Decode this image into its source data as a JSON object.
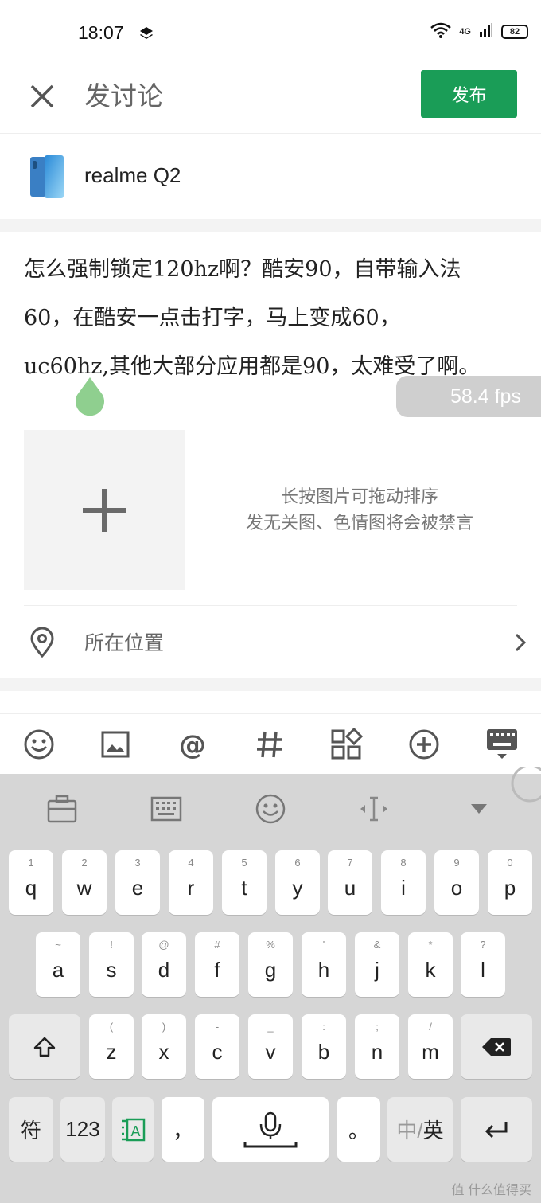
{
  "status": {
    "time": "18:07",
    "network": "4G",
    "battery": "82"
  },
  "header": {
    "title": "发讨论",
    "publish_label": "发布"
  },
  "device": {
    "name": "realme Q2"
  },
  "post": {
    "lines": [
      "怎么强制锁定120hz啊？酷安90，自带输入法",
      "60，在酷安一点击打字，马上变成60，",
      "uc60hz,其他大部分应用都是90，太难受了啊。"
    ]
  },
  "overlay": {
    "fps": "58.4 fps"
  },
  "image_picker": {
    "hint_line1": "长按图片可拖动排序",
    "hint_line2": "发无关图、色情图将会被禁言"
  },
  "location": {
    "label": "所在位置"
  },
  "toolbar": {
    "icons": [
      "emoji-icon",
      "image-icon",
      "at-icon",
      "hashtag-icon",
      "apps-icon",
      "add-circle-icon",
      "keyboard-hide-icon"
    ]
  },
  "keyboard": {
    "row1": [
      {
        "sub": "1",
        "key": "q"
      },
      {
        "sub": "2",
        "key": "w"
      },
      {
        "sub": "3",
        "key": "e"
      },
      {
        "sub": "4",
        "key": "r"
      },
      {
        "sub": "5",
        "key": "t"
      },
      {
        "sub": "6",
        "key": "y"
      },
      {
        "sub": "7",
        "key": "u"
      },
      {
        "sub": "8",
        "key": "i"
      },
      {
        "sub": "9",
        "key": "o"
      },
      {
        "sub": "0",
        "key": "p"
      }
    ],
    "row2": [
      {
        "sub": "~",
        "key": "a"
      },
      {
        "sub": "!",
        "key": "s"
      },
      {
        "sub": "@",
        "key": "d"
      },
      {
        "sub": "#",
        "key": "f"
      },
      {
        "sub": "%",
        "key": "g"
      },
      {
        "sub": "'",
        "key": "h"
      },
      {
        "sub": "&",
        "key": "j"
      },
      {
        "sub": "*",
        "key": "k"
      },
      {
        "sub": "?",
        "key": "l"
      }
    ],
    "row3": [
      {
        "sub": "(",
        "key": "z"
      },
      {
        "sub": ")",
        "key": "x"
      },
      {
        "sub": "-",
        "key": "c"
      },
      {
        "sub": "_",
        "key": "v"
      },
      {
        "sub": ":",
        "key": "b"
      },
      {
        "sub": ";",
        "key": "n"
      },
      {
        "sub": "/",
        "key": "m"
      }
    ],
    "symbol_label": "符",
    "numbers_label": "123",
    "comma": "，",
    "period": "。",
    "lang_cn": "中/",
    "lang_en": "英",
    "watermark": "值 什么值得买"
  },
  "colors": {
    "accent": "#1a9d57",
    "drop": "#8fcf8f"
  }
}
